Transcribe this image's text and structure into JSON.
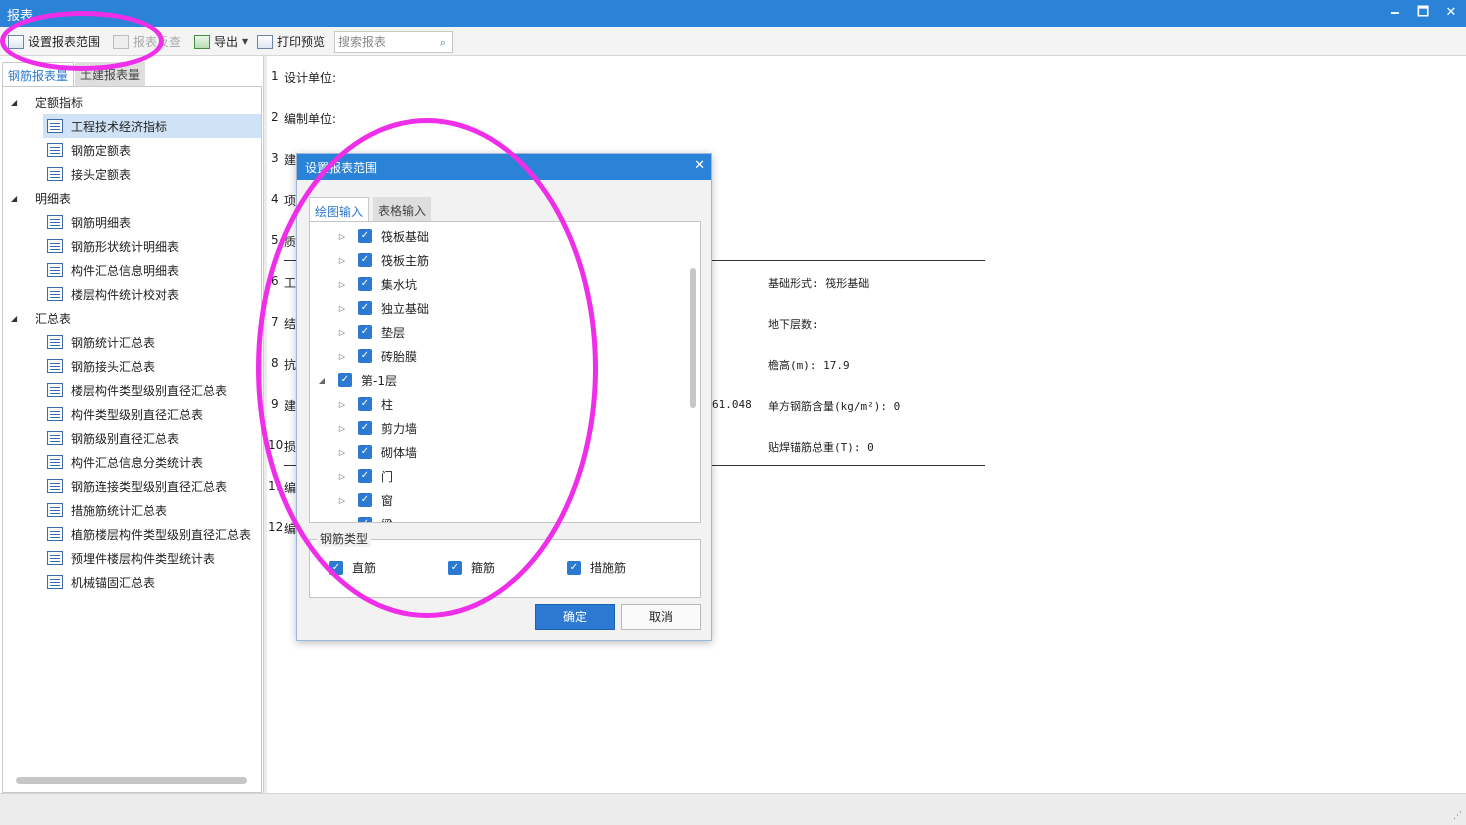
{
  "window": {
    "title": "报表",
    "minimize": "🗕",
    "maximize": "🗖",
    "close": "✕"
  },
  "toolbar": {
    "set_range": "设置报表范围",
    "report_check": "报表反查",
    "export": "导出",
    "print_preview": "打印预览",
    "search_placeholder": "搜索报表"
  },
  "left_tabs": {
    "rebar": "钢筋报表量",
    "civil": "土建报表量"
  },
  "tree": {
    "groups": [
      {
        "label": "定额指标",
        "items": [
          "工程技术经济指标",
          "钢筋定额表",
          "接头定额表"
        ]
      },
      {
        "label": "明细表",
        "items": [
          "钢筋明细表",
          "钢筋形状统计明细表",
          "构件汇总信息明细表",
          "楼层构件统计校对表"
        ]
      },
      {
        "label": "汇总表",
        "items": [
          "钢筋统计汇总表",
          "钢筋接头汇总表",
          "楼层构件类型级别直径汇总表",
          "构件类型级别直径汇总表",
          "钢筋级别直径汇总表",
          "构件汇总信息分类统计表",
          "钢筋连接类型级别直径汇总表",
          "措施筋统计汇总表",
          "植筋楼层构件类型级别直径汇总表",
          "预埋件楼层构件类型统计表",
          "机械锚固汇总表"
        ]
      }
    ],
    "selected": "工程技术经济指标"
  },
  "report": {
    "rows": [
      {
        "num": "1",
        "label": "设计单位:"
      },
      {
        "num": "2",
        "label": "编制单位:"
      },
      {
        "num": "3",
        "label": "建"
      },
      {
        "num": "4",
        "label": "项"
      },
      {
        "num": "5",
        "label": "质"
      },
      {
        "num": "6",
        "label": "工"
      },
      {
        "num": "7",
        "label": "结"
      },
      {
        "num": "8",
        "label": "抗"
      },
      {
        "num": "9",
        "label": "建"
      },
      {
        "num": "10",
        "label": "损"
      },
      {
        "num": "11",
        "label": "编"
      },
      {
        "num": "12",
        "label": "编"
      }
    ],
    "foundation_type": "基础形式: 筏形基础",
    "basement_floors": "地下层数:",
    "eave_height": "檐高(m): 17.9",
    "partial_value": "61.048",
    "rebar_per_m2": "单方钢筋含量(kg/m²): 0",
    "weld_anchor_weight": "贴焊锚筋总重(T): 0"
  },
  "dialog": {
    "title": "设置报表范围",
    "tab_drawing": "绘图输入",
    "tab_table": "表格输入",
    "tree_items": [
      {
        "label": "筏板基础",
        "level": 2
      },
      {
        "label": "筏板主筋",
        "level": 2
      },
      {
        "label": "集水坑",
        "level": 2
      },
      {
        "label": "独立基础",
        "level": 2
      },
      {
        "label": "垫层",
        "level": 2
      },
      {
        "label": "砖胎膜",
        "level": 2
      },
      {
        "label": "第-1层",
        "level": 1
      },
      {
        "label": "柱",
        "level": 2
      },
      {
        "label": "剪力墙",
        "level": 2
      },
      {
        "label": "砌体墙",
        "level": 2
      },
      {
        "label": "门",
        "level": 2
      },
      {
        "label": "窗",
        "level": 2
      },
      {
        "label": "梁",
        "level": 2
      }
    ],
    "rebar_type_title": "钢筋类型",
    "rebar_types": [
      "直筋",
      "箍筋",
      "措施筋"
    ],
    "ok": "确定",
    "cancel": "取消"
  },
  "colors": {
    "titlebar": "#2b83d8",
    "accent": "#2b79d0",
    "annotation": "#ee2ee8",
    "selected_row": "#d0e2f6"
  }
}
